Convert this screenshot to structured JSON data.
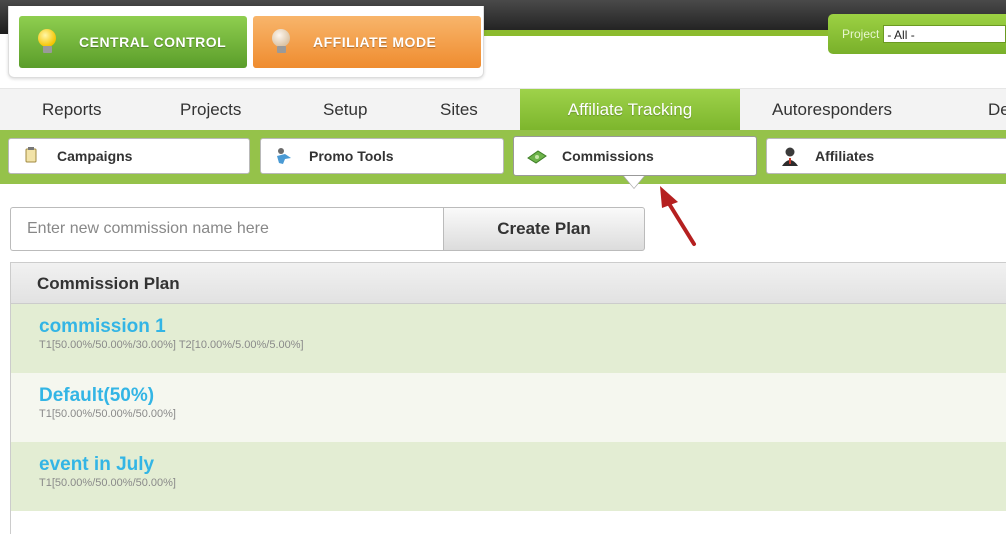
{
  "header": {
    "central_label": "CENTRAL CONTROL",
    "affiliate_label": "AFFILIATE MODE",
    "project_label": "Project",
    "project_value": "- All -"
  },
  "main_nav": {
    "items": [
      "Reports",
      "Projects",
      "Setup",
      "Sites",
      "Affiliate Tracking",
      "Autoresponders",
      "De"
    ],
    "active": "Affiliate Tracking"
  },
  "sub_nav": {
    "tabs": [
      "Campaigns",
      "Promo Tools",
      "Commissions",
      "Affiliates"
    ],
    "active": "Commissions"
  },
  "create_plan": {
    "placeholder": "Enter new commission name here",
    "button_label": "Create Plan"
  },
  "table": {
    "header": "Commission Plan",
    "rows": [
      {
        "name": "commission 1",
        "tiers": "T1[50.00%/50.00%/30.00%] T2[10.00%/5.00%/5.00%]"
      },
      {
        "name": "Default(50%)",
        "tiers": "T1[50.00%/50.00%/50.00%]"
      },
      {
        "name": "event in July",
        "tiers": "T1[50.00%/50.00%/50.00%]"
      }
    ]
  },
  "colors": {
    "accent_green": "#8cbb2e",
    "link_blue": "#33b5e5",
    "annotation_arrow": "#b52020"
  }
}
